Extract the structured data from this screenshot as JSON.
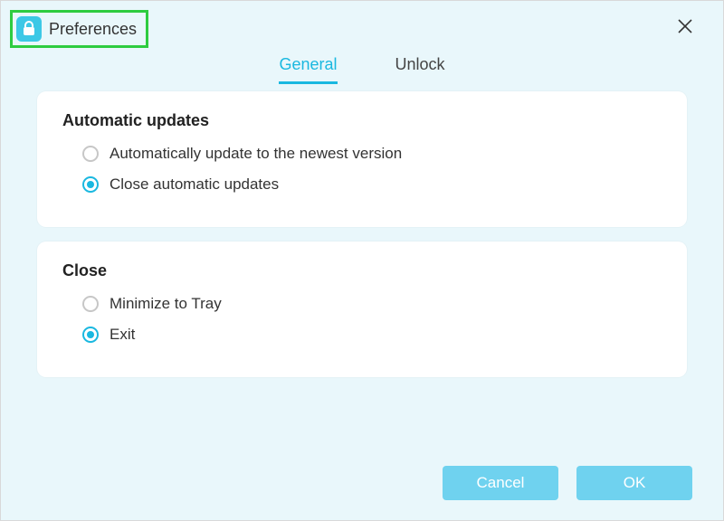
{
  "window": {
    "title": "Preferences",
    "close_label": "Close"
  },
  "tabs": {
    "general": "General",
    "unlock": "Unlock",
    "active": "general"
  },
  "sections": {
    "updates": {
      "title": "Automatic updates",
      "option_auto": "Automatically update to the newest version",
      "option_close": "Close automatic updates",
      "selected": "close"
    },
    "close": {
      "title": "Close",
      "option_tray": "Minimize to Tray",
      "option_exit": "Exit",
      "selected": "exit"
    }
  },
  "footer": {
    "cancel": "Cancel",
    "ok": "OK"
  },
  "colors": {
    "accent": "#1ab8e0",
    "button": "#6fd2ef",
    "panel_bg": "#e9f7fb",
    "highlight_border": "#2ecc40"
  },
  "icons": {
    "app": "lock-icon",
    "close": "close-icon"
  }
}
